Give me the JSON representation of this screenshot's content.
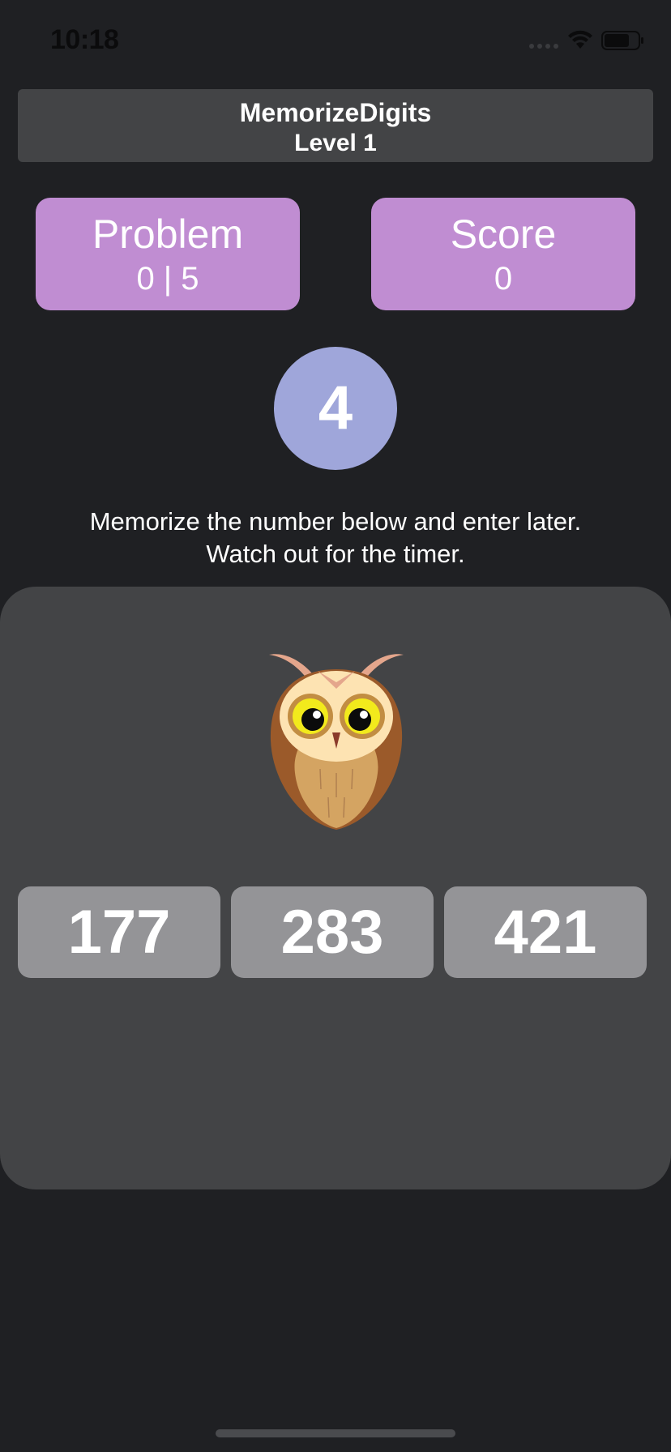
{
  "status_bar": {
    "time": "10:18"
  },
  "header": {
    "app_title": "MemorizeDigits",
    "level": "Level 1"
  },
  "stats": {
    "problem_label": "Problem",
    "problem_value": "0 | 5",
    "score_label": "Score",
    "score_value": "0"
  },
  "timer": {
    "value": "4"
  },
  "instructions": {
    "line1": "Memorize the number below and enter later.",
    "line2": "Watch out for the timer."
  },
  "numbers": [
    "177",
    "283",
    "421"
  ],
  "colors": {
    "background": "#1f2023",
    "panel": "#434446",
    "stat_card": "#c08dd2",
    "timer_circle": "#9fa6da",
    "number_tile": "#949497"
  },
  "icons": {
    "wifi": "wifi-icon",
    "battery": "battery-icon",
    "mascot": "owl-icon"
  }
}
